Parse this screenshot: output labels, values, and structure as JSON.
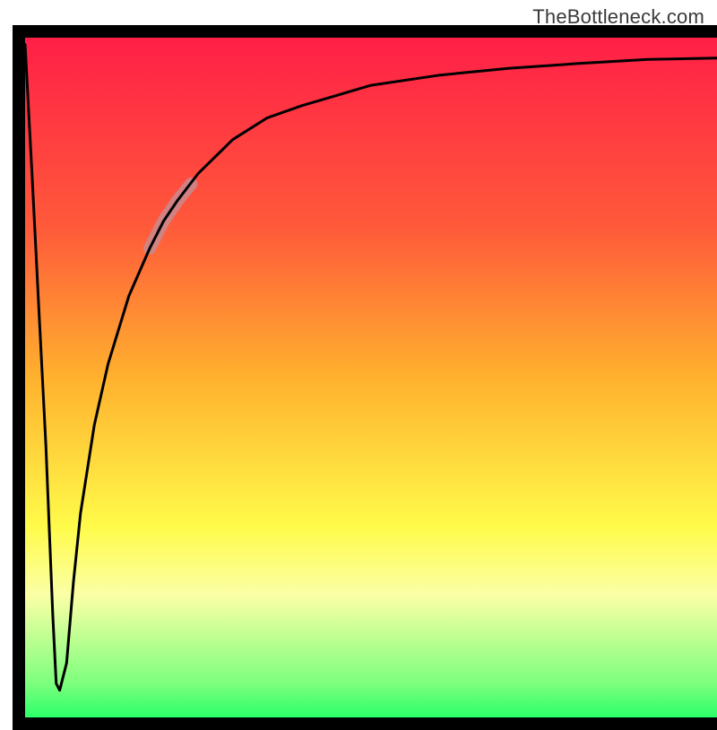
{
  "watermark": "TheBottleneck.com",
  "chart_data": {
    "type": "line",
    "title": "",
    "xlabel": "",
    "ylabel": "",
    "xlim": [
      0,
      100
    ],
    "ylim": [
      0,
      100
    ],
    "grid": false,
    "legend": false,
    "gradient_colors": {
      "top": "#ff1f47",
      "mid_upper": "#ffb12e",
      "mid": "#fffb4a",
      "mid_lower": "#fbffa6",
      "bottom": "#2bff6a"
    },
    "series": [
      {
        "name": "bottleneck-curve",
        "stroke": "#000000",
        "stroke_width": 3,
        "x": [
          0,
          1,
          2,
          3,
          4,
          4.5,
          5,
          6,
          7,
          8,
          10,
          12,
          15,
          18,
          20,
          22,
          25,
          30,
          35,
          40,
          50,
          60,
          70,
          80,
          90,
          100
        ],
        "values": [
          99,
          80,
          60,
          40,
          15,
          5,
          4,
          8,
          20,
          30,
          43,
          52,
          62,
          69,
          73,
          76,
          80,
          85,
          88.2,
          90,
          93,
          94.5,
          95.5,
          96.2,
          96.8,
          97
        ]
      },
      {
        "name": "highlight-segment",
        "stroke": "#c98a8f",
        "stroke_width": 14,
        "opacity": 0.85,
        "x": [
          18,
          20,
          22,
          24
        ],
        "values": [
          69,
          73,
          76,
          78.5
        ]
      }
    ],
    "annotations": []
  }
}
